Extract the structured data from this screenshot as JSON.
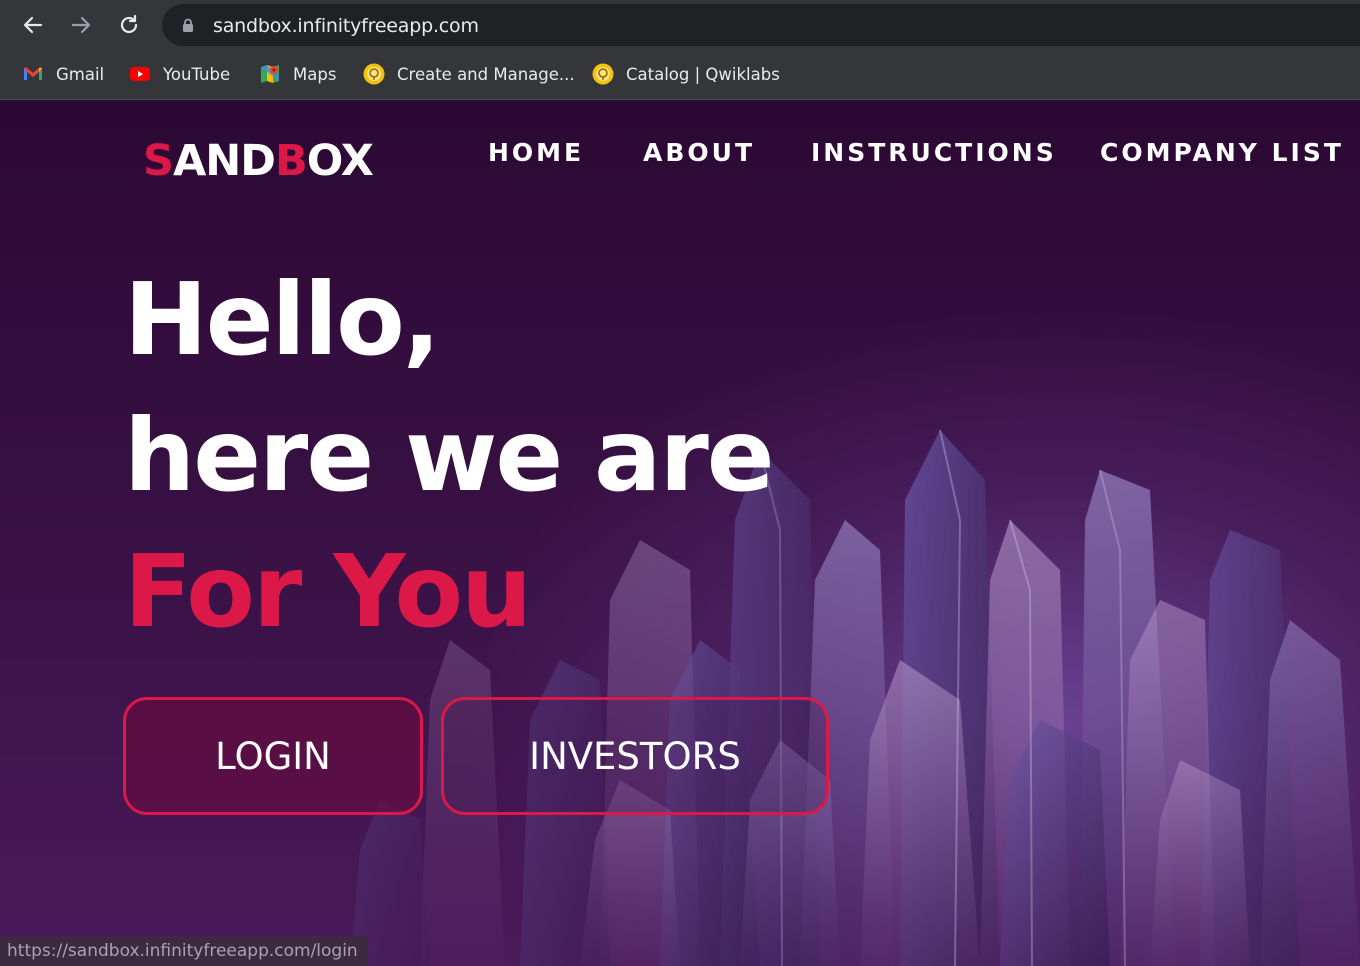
{
  "browser": {
    "url": "sandbox.infinityfreeapp.com",
    "nav_icons": [
      "back-arrow-icon",
      "forward-arrow-icon",
      "reload-icon"
    ],
    "bookmarks": [
      {
        "label": "Gmail",
        "icon": "gmail-icon"
      },
      {
        "label": "YouTube",
        "icon": "youtube-icon"
      },
      {
        "label": "Maps",
        "icon": "maps-icon"
      },
      {
        "label": "Create and Manage...",
        "icon": "qwiklabs-icon"
      },
      {
        "label": "Catalog | Qwiklabs",
        "icon": "qwiklabs-icon"
      }
    ],
    "status_url": "https://sandbox.infinityfreeapp.com/login"
  },
  "site": {
    "logo": {
      "part1": "S",
      "part2": "AND",
      "part3": "B",
      "part4": "OX"
    },
    "nav": [
      "HOME",
      "ABOUT",
      "INSTRUCTIONS",
      "COMPANY LIST"
    ],
    "hero": {
      "line1": "Hello,",
      "line2": "here we are",
      "line3": "For You"
    },
    "buttons": {
      "login": "LOGIN",
      "investors": "INVESTORS"
    }
  },
  "colors": {
    "accent": "#dc1848",
    "background": "#2c0834",
    "chrome": "#35363a"
  }
}
